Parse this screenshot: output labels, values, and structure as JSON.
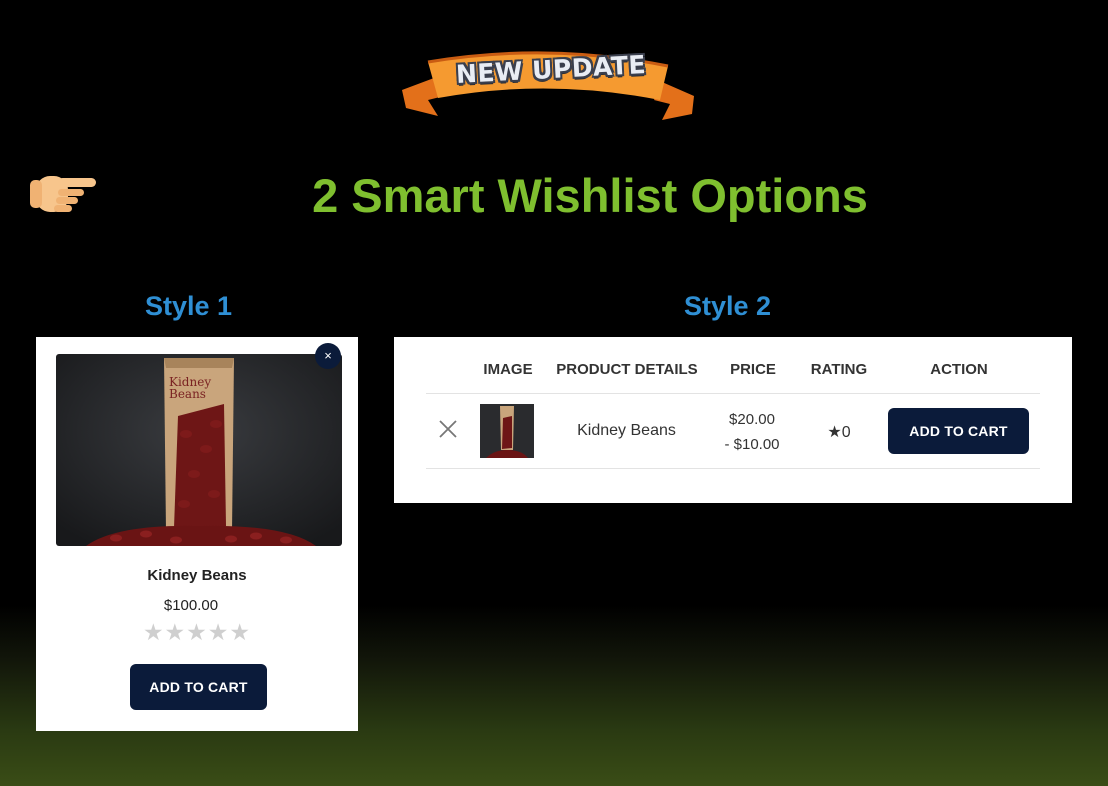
{
  "banner": {
    "text": "NEW UPDATE"
  },
  "headline": "2 Smart Wishlist Options",
  "style1": {
    "label": "Style 1",
    "close_icon": "×",
    "product_name": "Kidney Beans",
    "price": "$100.00",
    "stars": "★★★★★",
    "add_to_cart": "ADD TO CART"
  },
  "style2": {
    "label": "Style 2",
    "headers": {
      "image": "IMAGE",
      "details": "PRODUCT DETAILS",
      "price": "PRICE",
      "rating": "RATING",
      "action": "ACTION"
    },
    "row": {
      "product_name": "Kidney Beans",
      "price_high": "$20.00",
      "price_low": "- $10.00",
      "rating": "★0",
      "add_to_cart": "ADD TO CART"
    }
  },
  "colors": {
    "headline": "#7fbf2f",
    "style_label": "#2f8fd4",
    "button": "#0b1b3a",
    "banner_ribbon": "#f08a24"
  },
  "icons": [
    "pointing-hand-icon",
    "close-icon",
    "remove-x-icon",
    "star-icon"
  ]
}
